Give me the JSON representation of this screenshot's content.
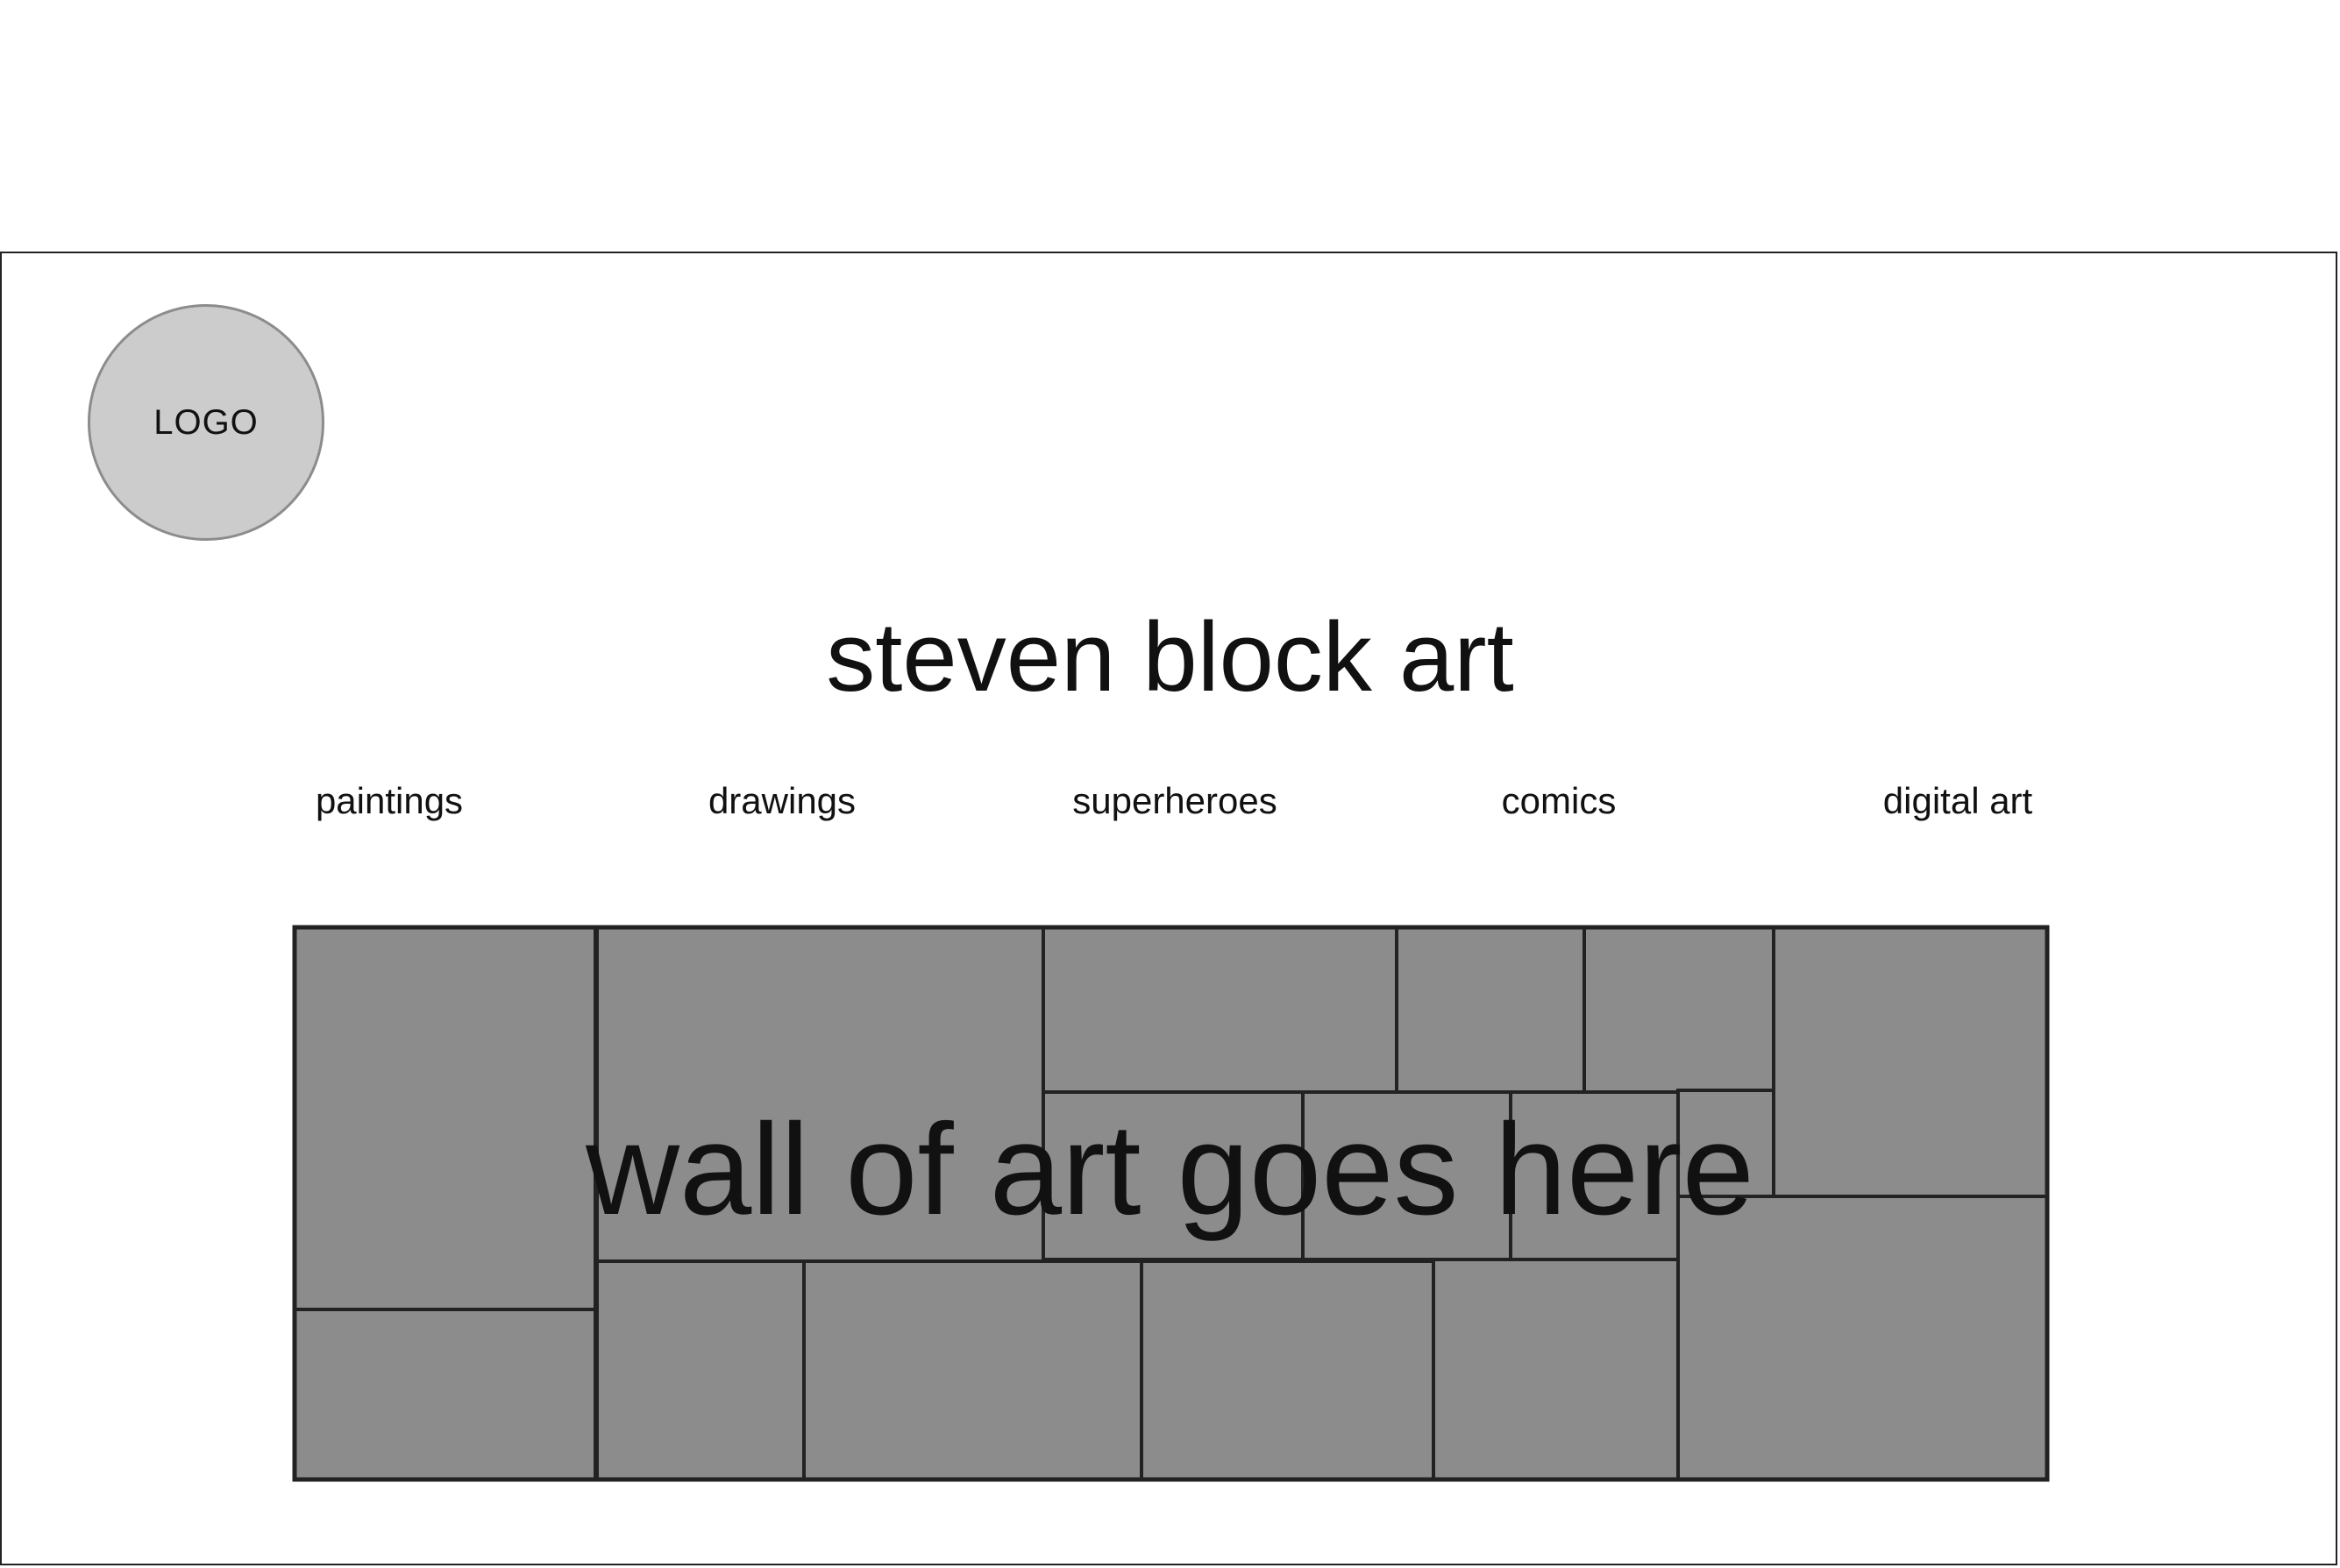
{
  "logo": {
    "label": "LOGO"
  },
  "header": {
    "title": "steven block art"
  },
  "nav": {
    "items": [
      {
        "label": "paintings"
      },
      {
        "label": "drawings"
      },
      {
        "label": "superheroes"
      },
      {
        "label": "comics"
      },
      {
        "label": "digital art"
      }
    ]
  },
  "wall": {
    "label": "wall of art goes here",
    "tile_color": "#8c8c8c",
    "border_color": "#222222"
  }
}
